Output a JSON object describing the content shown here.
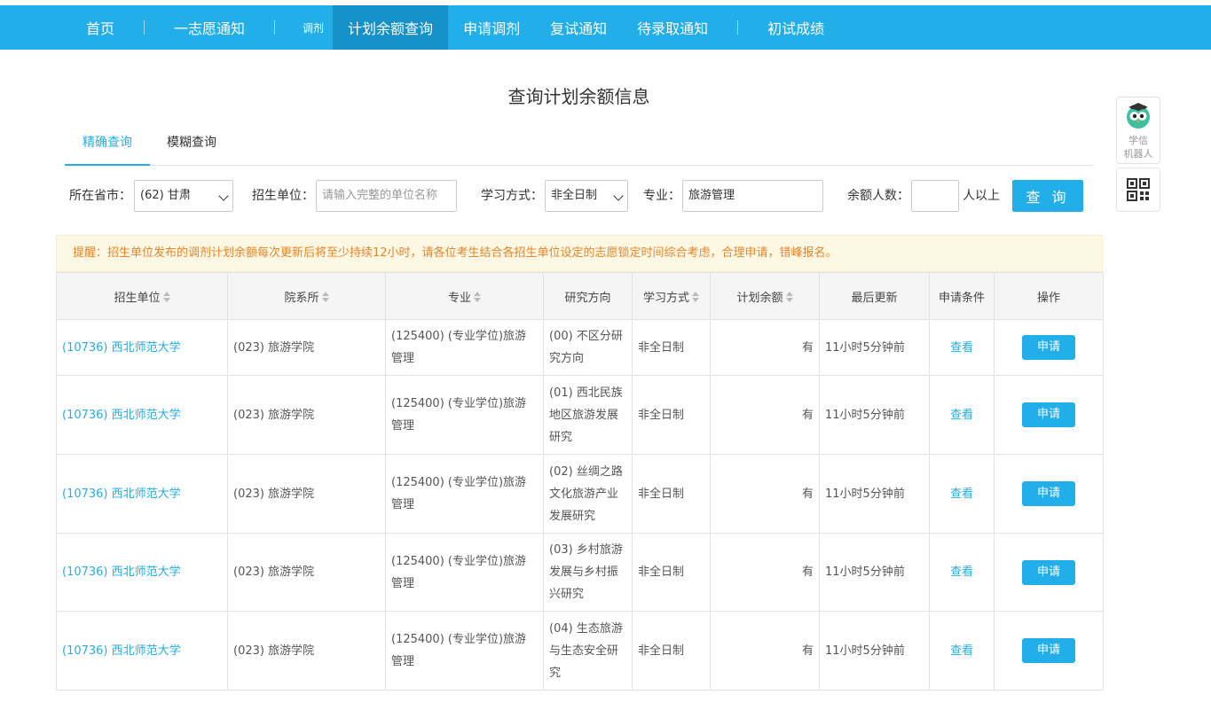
{
  "nav": {
    "home": "首页",
    "first_choice": "一志愿通知",
    "adjust_small": "调剂",
    "quota_query": "计划余额查询",
    "apply_adjust": "申请调剂",
    "retest_notice": "复试通知",
    "pending_admission": "待录取通知",
    "initial_scores": "初试成绩"
  },
  "page_title": "查询计划余额信息",
  "tabs": {
    "exact": "精确查询",
    "fuzzy": "模糊查询"
  },
  "filter": {
    "province_label": "所在省市：",
    "province_value": "(62) 甘肃",
    "unit_label": "招生单位：",
    "unit_placeholder": "请输入完整的单位名称",
    "mode_label": "学习方式：",
    "mode_value": "非全日制",
    "major_label": "专业：",
    "major_value": "旅游管理",
    "quota_label": "余额人数：",
    "quota_value": "",
    "quota_suffix": "人以上",
    "search_button": "查 询"
  },
  "notice": "提醒：招生单位发布的调剂计划余额每次更新后将至少持续12小时，请各位考生结合各招生单位设定的志愿锁定时间综合考虑，合理申请，错峰报名。",
  "table": {
    "headers": {
      "unit": "招生单位",
      "department": "院系所",
      "major": "专业",
      "direction": "研究方向",
      "mode": "学习方式",
      "quota": "计划余额",
      "updated": "最后更新",
      "conditions": "申请条件",
      "action": "操作"
    },
    "rows": [
      {
        "unit": "(10736) 西北师范大学",
        "department": "(023) 旅游学院",
        "major": "(125400) (专业学位)旅游管理",
        "direction": "(00) 不区分研究方向",
        "mode": "非全日制",
        "quota": "有",
        "updated": "11小时5分钟前",
        "conditions": "查看",
        "action": "申请"
      },
      {
        "unit": "(10736) 西北师范大学",
        "department": "(023) 旅游学院",
        "major": "(125400) (专业学位)旅游管理",
        "direction": "(01) 西北民族地区旅游发展研究",
        "mode": "非全日制",
        "quota": "有",
        "updated": "11小时5分钟前",
        "conditions": "查看",
        "action": "申请"
      },
      {
        "unit": "(10736) 西北师范大学",
        "department": "(023) 旅游学院",
        "major": "(125400) (专业学位)旅游管理",
        "direction": "(02) 丝绸之路文化旅游产业发展研究",
        "mode": "非全日制",
        "quota": "有",
        "updated": "11小时5分钟前",
        "conditions": "查看",
        "action": "申请"
      },
      {
        "unit": "(10736) 西北师范大学",
        "department": "(023) 旅游学院",
        "major": "(125400) (专业学位)旅游管理",
        "direction": "(03) 乡村旅游发展与乡村振兴研究",
        "mode": "非全日制",
        "quota": "有",
        "updated": "11小时5分钟前",
        "conditions": "查看",
        "action": "申请"
      },
      {
        "unit": "(10736) 西北师范大学",
        "department": "(023) 旅游学院",
        "major": "(125400) (专业学位)旅游管理",
        "direction": "(04) 生态旅游与生态安全研究",
        "mode": "非全日制",
        "quota": "有",
        "updated": "11小时5分钟前",
        "conditions": "查看",
        "action": "申请"
      }
    ]
  },
  "side": {
    "robot_label_1": "学信",
    "robot_label_2": "机器人",
    "robot_icon": "robot-owl-icon",
    "qr_icon": "qr-code-icon"
  },
  "colors": {
    "brand": "#22aee8",
    "nav_active": "#1690c8",
    "notice_text": "#e6842c",
    "notice_bg": "#fcf8e3"
  }
}
